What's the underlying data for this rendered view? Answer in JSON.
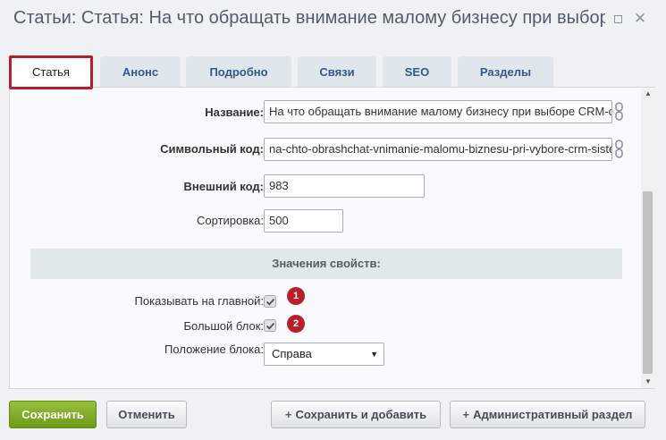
{
  "window": {
    "title": "Статьи: Статья: На что обращать внимание малому бизнесу при выборе CRM-системы"
  },
  "tabs": [
    {
      "label": "Статья",
      "active": true
    },
    {
      "label": "Анонс"
    },
    {
      "label": "Подробно"
    },
    {
      "label": "Связи"
    },
    {
      "label": "SEO"
    },
    {
      "label": "Разделы"
    }
  ],
  "form": {
    "name_label": "Название:",
    "name_value": "На что обращать внимание малому бизнесу при выборе CRM-системы",
    "code_label": "Символьный код:",
    "code_value": "na-chto-obrashchat-vnimanie-malomu-biznesu-pri-vybore-crm-sistemy",
    "ext_code_label": "Внешний код:",
    "ext_code_value": "983",
    "sort_label": "Сортировка:",
    "sort_value": "500",
    "props_header": "Значения свойств:",
    "show_main_label": "Показывать на главной:",
    "show_main_checked": true,
    "show_main_badge": "1",
    "big_block_label": "Большой блок:",
    "big_block_checked": true,
    "big_block_badge": "2",
    "position_label": "Положение блока:",
    "position_value": "Справа"
  },
  "footer": {
    "save": "Сохранить",
    "cancel": "Отменить",
    "save_add": "Сохранить и добавить",
    "admin_section": "Административный раздел"
  },
  "colors": {
    "accent_red": "#b81f2b",
    "save_green": "#7aa51f",
    "tab_text": "#34588a"
  }
}
